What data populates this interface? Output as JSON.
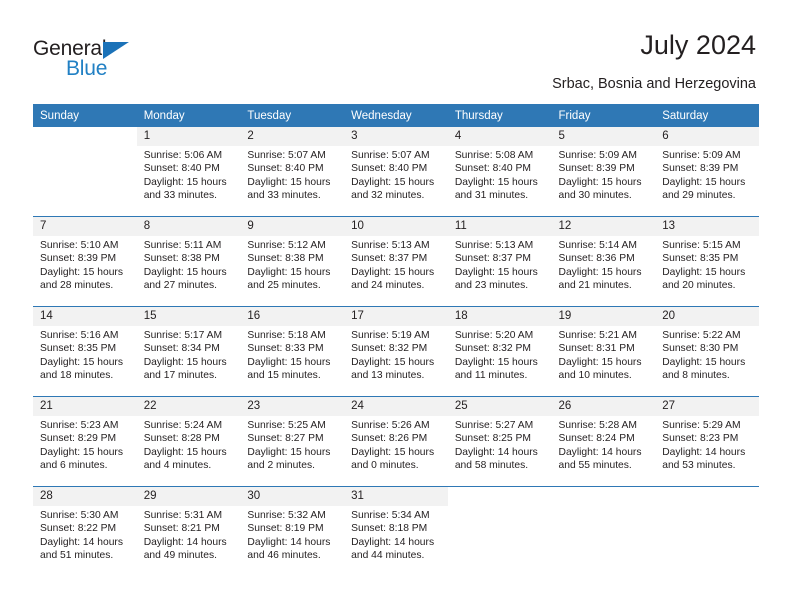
{
  "brand": {
    "name_part1": "General",
    "name_part2": "Blue",
    "triangle_color": "#1b72b8",
    "text_color": "#231f20",
    "blue_color": "#2180c4"
  },
  "header": {
    "title": "July 2024",
    "subtitle": "Srbac, Bosnia and Herzegovina"
  },
  "theme": {
    "header_bg": "#2f78b5",
    "header_text": "#ffffff",
    "daynum_bg": "#f2f2f2",
    "cell_bg": "#ffffff",
    "divider": "#2f78b5"
  },
  "calendar": {
    "weekday_headers": [
      "Sunday",
      "Monday",
      "Tuesday",
      "Wednesday",
      "Thursday",
      "Friday",
      "Saturday"
    ],
    "weeks": [
      [
        {
          "day": "",
          "lines": []
        },
        {
          "day": "1",
          "lines": [
            "Sunrise: 5:06 AM",
            "Sunset: 8:40 PM",
            "Daylight: 15 hours",
            "and 33 minutes."
          ]
        },
        {
          "day": "2",
          "lines": [
            "Sunrise: 5:07 AM",
            "Sunset: 8:40 PM",
            "Daylight: 15 hours",
            "and 33 minutes."
          ]
        },
        {
          "day": "3",
          "lines": [
            "Sunrise: 5:07 AM",
            "Sunset: 8:40 PM",
            "Daylight: 15 hours",
            "and 32 minutes."
          ]
        },
        {
          "day": "4",
          "lines": [
            "Sunrise: 5:08 AM",
            "Sunset: 8:40 PM",
            "Daylight: 15 hours",
            "and 31 minutes."
          ]
        },
        {
          "day": "5",
          "lines": [
            "Sunrise: 5:09 AM",
            "Sunset: 8:39 PM",
            "Daylight: 15 hours",
            "and 30 minutes."
          ]
        },
        {
          "day": "6",
          "lines": [
            "Sunrise: 5:09 AM",
            "Sunset: 8:39 PM",
            "Daylight: 15 hours",
            "and 29 minutes."
          ]
        }
      ],
      [
        {
          "day": "7",
          "lines": [
            "Sunrise: 5:10 AM",
            "Sunset: 8:39 PM",
            "Daylight: 15 hours",
            "and 28 minutes."
          ]
        },
        {
          "day": "8",
          "lines": [
            "Sunrise: 5:11 AM",
            "Sunset: 8:38 PM",
            "Daylight: 15 hours",
            "and 27 minutes."
          ]
        },
        {
          "day": "9",
          "lines": [
            "Sunrise: 5:12 AM",
            "Sunset: 8:38 PM",
            "Daylight: 15 hours",
            "and 25 minutes."
          ]
        },
        {
          "day": "10",
          "lines": [
            "Sunrise: 5:13 AM",
            "Sunset: 8:37 PM",
            "Daylight: 15 hours",
            "and 24 minutes."
          ]
        },
        {
          "day": "11",
          "lines": [
            "Sunrise: 5:13 AM",
            "Sunset: 8:37 PM",
            "Daylight: 15 hours",
            "and 23 minutes."
          ]
        },
        {
          "day": "12",
          "lines": [
            "Sunrise: 5:14 AM",
            "Sunset: 8:36 PM",
            "Daylight: 15 hours",
            "and 21 minutes."
          ]
        },
        {
          "day": "13",
          "lines": [
            "Sunrise: 5:15 AM",
            "Sunset: 8:35 PM",
            "Daylight: 15 hours",
            "and 20 minutes."
          ]
        }
      ],
      [
        {
          "day": "14",
          "lines": [
            "Sunrise: 5:16 AM",
            "Sunset: 8:35 PM",
            "Daylight: 15 hours",
            "and 18 minutes."
          ]
        },
        {
          "day": "15",
          "lines": [
            "Sunrise: 5:17 AM",
            "Sunset: 8:34 PM",
            "Daylight: 15 hours",
            "and 17 minutes."
          ]
        },
        {
          "day": "16",
          "lines": [
            "Sunrise: 5:18 AM",
            "Sunset: 8:33 PM",
            "Daylight: 15 hours",
            "and 15 minutes."
          ]
        },
        {
          "day": "17",
          "lines": [
            "Sunrise: 5:19 AM",
            "Sunset: 8:32 PM",
            "Daylight: 15 hours",
            "and 13 minutes."
          ]
        },
        {
          "day": "18",
          "lines": [
            "Sunrise: 5:20 AM",
            "Sunset: 8:32 PM",
            "Daylight: 15 hours",
            "and 11 minutes."
          ]
        },
        {
          "day": "19",
          "lines": [
            "Sunrise: 5:21 AM",
            "Sunset: 8:31 PM",
            "Daylight: 15 hours",
            "and 10 minutes."
          ]
        },
        {
          "day": "20",
          "lines": [
            "Sunrise: 5:22 AM",
            "Sunset: 8:30 PM",
            "Daylight: 15 hours",
            "and 8 minutes."
          ]
        }
      ],
      [
        {
          "day": "21",
          "lines": [
            "Sunrise: 5:23 AM",
            "Sunset: 8:29 PM",
            "Daylight: 15 hours",
            "and 6 minutes."
          ]
        },
        {
          "day": "22",
          "lines": [
            "Sunrise: 5:24 AM",
            "Sunset: 8:28 PM",
            "Daylight: 15 hours",
            "and 4 minutes."
          ]
        },
        {
          "day": "23",
          "lines": [
            "Sunrise: 5:25 AM",
            "Sunset: 8:27 PM",
            "Daylight: 15 hours",
            "and 2 minutes."
          ]
        },
        {
          "day": "24",
          "lines": [
            "Sunrise: 5:26 AM",
            "Sunset: 8:26 PM",
            "Daylight: 15 hours",
            "and 0 minutes."
          ]
        },
        {
          "day": "25",
          "lines": [
            "Sunrise: 5:27 AM",
            "Sunset: 8:25 PM",
            "Daylight: 14 hours",
            "and 58 minutes."
          ]
        },
        {
          "day": "26",
          "lines": [
            "Sunrise: 5:28 AM",
            "Sunset: 8:24 PM",
            "Daylight: 14 hours",
            "and 55 minutes."
          ]
        },
        {
          "day": "27",
          "lines": [
            "Sunrise: 5:29 AM",
            "Sunset: 8:23 PM",
            "Daylight: 14 hours",
            "and 53 minutes."
          ]
        }
      ],
      [
        {
          "day": "28",
          "lines": [
            "Sunrise: 5:30 AM",
            "Sunset: 8:22 PM",
            "Daylight: 14 hours",
            "and 51 minutes."
          ]
        },
        {
          "day": "29",
          "lines": [
            "Sunrise: 5:31 AM",
            "Sunset: 8:21 PM",
            "Daylight: 14 hours",
            "and 49 minutes."
          ]
        },
        {
          "day": "30",
          "lines": [
            "Sunrise: 5:32 AM",
            "Sunset: 8:19 PM",
            "Daylight: 14 hours",
            "and 46 minutes."
          ]
        },
        {
          "day": "31",
          "lines": [
            "Sunrise: 5:34 AM",
            "Sunset: 8:18 PM",
            "Daylight: 14 hours",
            "and 44 minutes."
          ]
        },
        {
          "day": "",
          "lines": []
        },
        {
          "day": "",
          "lines": []
        },
        {
          "day": "",
          "lines": []
        }
      ]
    ]
  }
}
